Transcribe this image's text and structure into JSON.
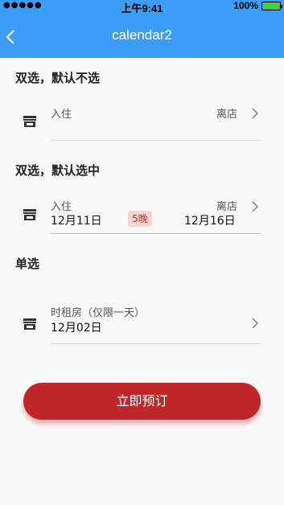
{
  "status_bar": {
    "signal": "●●●●●",
    "time": "上午9:41",
    "battery_text": "100%"
  },
  "nav": {
    "title": "calendar2"
  },
  "sections": [
    {
      "title": "双选，默认不选",
      "checkin_label": "入住",
      "checkout_label": "离店"
    },
    {
      "title": "双选，默认选中",
      "checkin_label": "入住",
      "checkin_date": "12月11日",
      "nights": "5晚",
      "checkout_label": "离店",
      "checkout_date": "12月16日"
    },
    {
      "title": "单选",
      "label": "时租房（仅限一天）",
      "date": "12月02日"
    }
  ],
  "book_button": "立即预订",
  "colors": {
    "nav": "#3b9df8",
    "accent": "#c1262a",
    "badge_bg": "#f4d3d3"
  }
}
